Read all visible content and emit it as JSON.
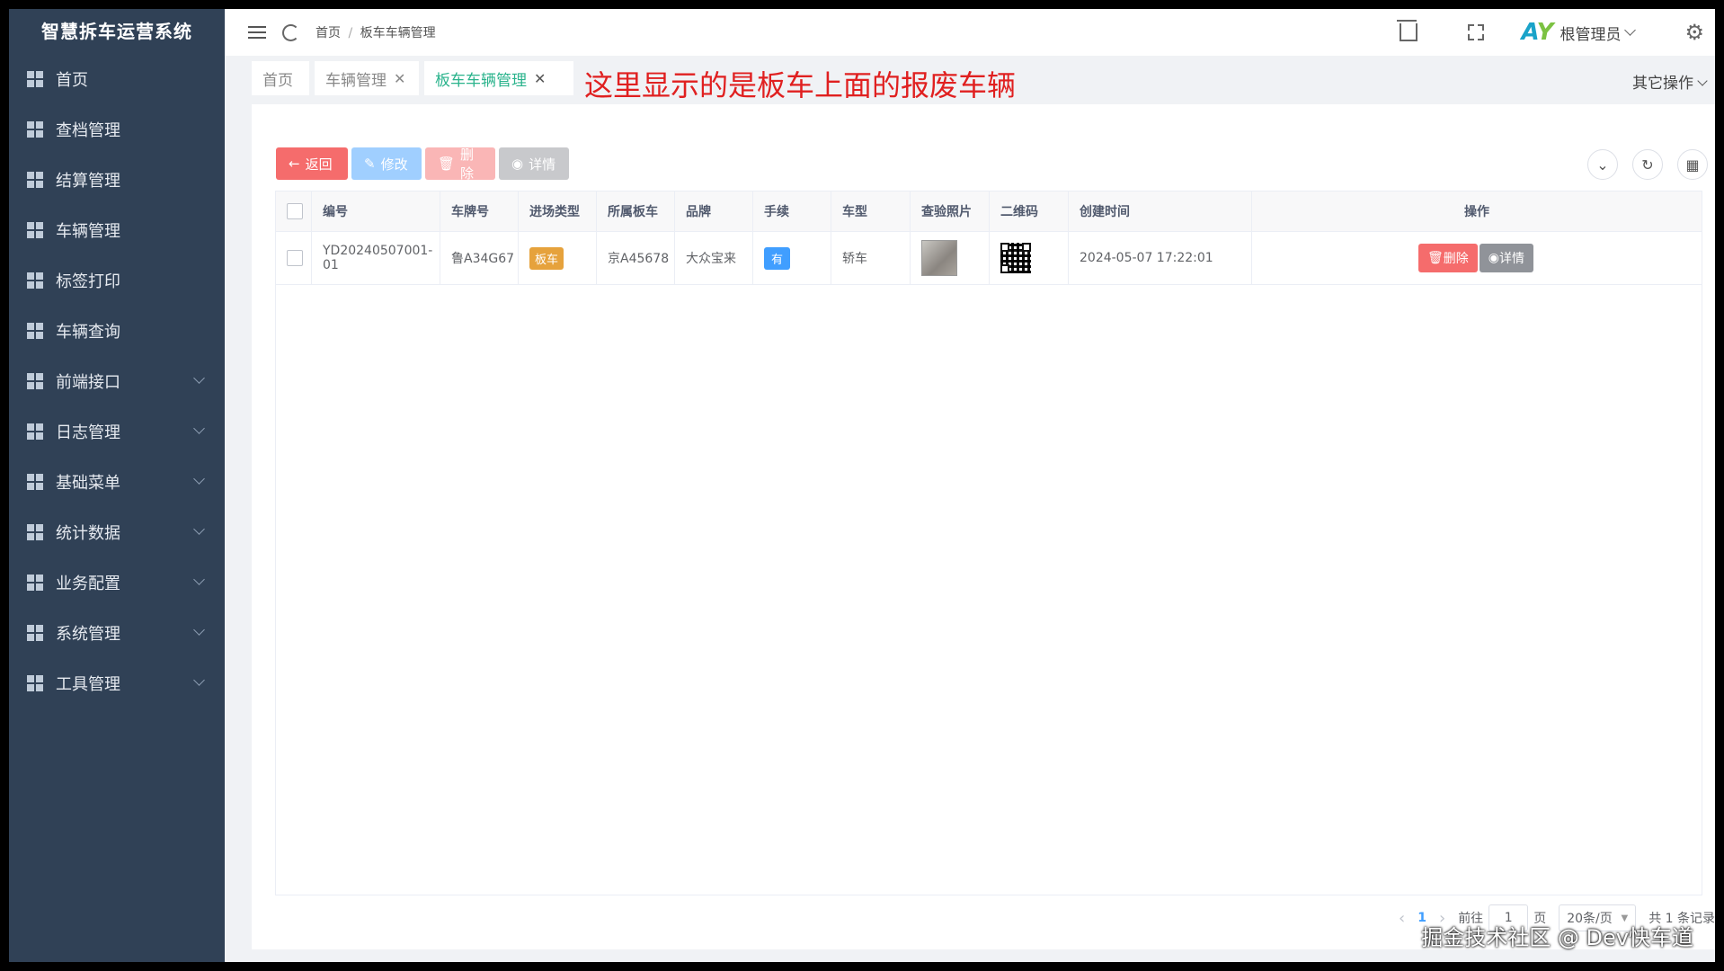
{
  "app": {
    "title": "智慧拆车运营系统"
  },
  "sidebar": {
    "items": [
      {
        "label": "首页",
        "expandable": false
      },
      {
        "label": "查档管理",
        "expandable": false
      },
      {
        "label": "结算管理",
        "expandable": false
      },
      {
        "label": "车辆管理",
        "expandable": false
      },
      {
        "label": "标签打印",
        "expandable": false
      },
      {
        "label": "车辆查询",
        "expandable": false
      },
      {
        "label": "前端接口",
        "expandable": true
      },
      {
        "label": "日志管理",
        "expandable": true
      },
      {
        "label": "基础菜单",
        "expandable": true
      },
      {
        "label": "统计数据",
        "expandable": true
      },
      {
        "label": "业务配置",
        "expandable": true
      },
      {
        "label": "系统管理",
        "expandable": true
      },
      {
        "label": "工具管理",
        "expandable": true
      }
    ]
  },
  "navbar": {
    "breadcrumb": [
      "首页",
      "板车车辆管理"
    ],
    "breadcrumb_sep": "/",
    "username": "根管理员",
    "avatar_text": [
      "A",
      "Y"
    ]
  },
  "tags": [
    {
      "label": "首页",
      "closable": false,
      "active": false
    },
    {
      "label": "车辆管理",
      "closable": true,
      "active": false
    },
    {
      "label": "板车车辆管理",
      "closable": true,
      "active": true
    }
  ],
  "tag_close_glyph": "✕",
  "annotation": "这里显示的是板车上面的报废车辆",
  "other_ops": "其它操作",
  "toolbar": {
    "back": "返回",
    "edit": "修改",
    "delete": "删除",
    "detail": "详情"
  },
  "table": {
    "columns": [
      "编号",
      "车牌号",
      "进场类型",
      "所属板车",
      "品牌",
      "手续",
      "车型",
      "查验照片",
      "二维码",
      "创建时间",
      "操作"
    ],
    "rows": [
      {
        "code": "YD20240507001-01",
        "plate": "鲁A34G67",
        "entry_type": "板车",
        "flatbed": "京A45678",
        "brand": "大众宝来",
        "formalities": "有",
        "model": "轿车",
        "created": "2024-05-07 17:22:01",
        "op_delete": "删除",
        "op_detail": "详情"
      }
    ]
  },
  "pagination": {
    "current_page": "1",
    "goto_label": "前往",
    "goto_value": "1",
    "page_suffix": "页",
    "page_size": "20条/页",
    "total": "共 1 条记录"
  },
  "watermark": "掘金技术社区 @ Dev快车道",
  "colors": {
    "sidebar_bg": "#304156",
    "accent_green": "#2ab38c",
    "danger": "#f56c6c",
    "primary": "#409eff",
    "warning": "#e6a23c",
    "annotation_red": "#e02020"
  }
}
